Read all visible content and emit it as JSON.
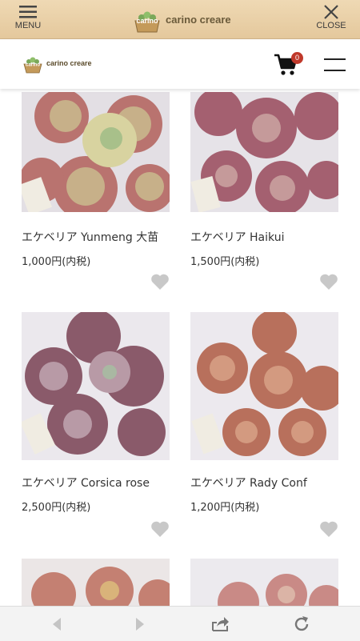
{
  "topbar": {
    "menu_label": "MENU",
    "close_label": "CLOSE",
    "logo_text": "carino creare"
  },
  "header": {
    "logo_text": "carino creare",
    "cart_count": "0"
  },
  "products": [
    {
      "name": "エケベリア Yunmeng 大苗",
      "price": "1,000円(内税)",
      "plate": "Yunmeng"
    },
    {
      "name": "エケベリア Haikui",
      "price": "1,500円(内税)",
      "plate": "Haikui"
    },
    {
      "name": "エケベリア Corsica rose",
      "price": "2,500円(内税)",
      "plate": "Corsica rose"
    },
    {
      "name": "エケベリア Rady Conf",
      "price": "1,200円(内税)",
      "plate": "Lady Conf"
    }
  ],
  "colors": {
    "topbar": "#e9cfa5",
    "heart": "#c8c8c8",
    "badge": "#c0392b"
  }
}
